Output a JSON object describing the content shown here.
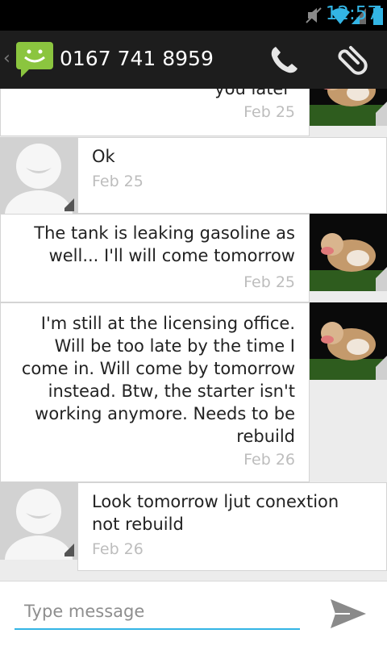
{
  "status_bar": {
    "time": "12:57"
  },
  "header": {
    "contact": "0167 741 8959"
  },
  "messages": [
    {
      "text": "you later",
      "time": "Feb 25",
      "from": "me"
    },
    {
      "text": "Ok",
      "time": "Feb 25",
      "from": "them"
    },
    {
      "text": "The tank is leaking gasoline as well... I'll will come tomorrow",
      "time": "Feb 25",
      "from": "me"
    },
    {
      "text": "I'm still at the licensing office. Will be too late by the time I come in. Will come by tomorrow instead. Btw, the starter isn't working anymore. Needs to be rebuild",
      "time": "Feb 26",
      "from": "me"
    },
    {
      "text": "Look tomorrow ljut conextion not rebuild",
      "time": "Feb 26",
      "from": "them"
    }
  ],
  "compose": {
    "placeholder": "Type message"
  },
  "colors": {
    "accent": "#33b5e5",
    "bar": "#1d1d1d",
    "app_green": "#8bc53f"
  }
}
